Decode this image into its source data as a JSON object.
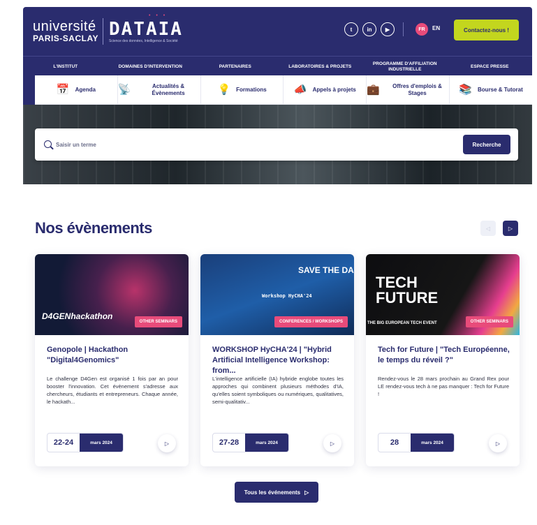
{
  "brand": {
    "universite": "université",
    "paris_saclay": "PARIS-SACLAY",
    "dataia_logo": "DATAIA",
    "dataia_tagline": "Science des données, Intelligence & Société"
  },
  "header": {
    "socials": [
      "twitter-icon",
      "linkedin-icon",
      "youtube-icon"
    ],
    "lang_fr": "FR",
    "lang_en": "EN",
    "contact_label": "Contactez-nous !"
  },
  "nav": {
    "items": [
      {
        "label": "L'institut"
      },
      {
        "label": "Domaines d'intervention"
      },
      {
        "label": "Partenaires"
      },
      {
        "label": "Laboratoires & projets"
      },
      {
        "label": "Programme d'affiliation industrielle"
      },
      {
        "label": "Espace presse"
      }
    ]
  },
  "subnav": {
    "items": [
      {
        "label": "Agenda",
        "icon": "calendar-icon"
      },
      {
        "label": "Actualités & Évènements",
        "icon": "megaphone-icon"
      },
      {
        "label": "Formations",
        "icon": "lightbulb-icon"
      },
      {
        "label": "Appels à projets",
        "icon": "announce-icon"
      },
      {
        "label": "Offres d'emplois & Stages",
        "icon": "briefcase-icon"
      },
      {
        "label": "Bourse & Tutorat",
        "icon": "books-icon"
      }
    ]
  },
  "search": {
    "placeholder": "Saisir un terme",
    "button_label": "Recherche"
  },
  "events": {
    "title": "Nos évènements",
    "cards": [
      {
        "image_text": "D4GENhackathon",
        "badge": "Other seminars",
        "title": "Genopole | Hackathon \"Digital4Genomics\"",
        "description": "Le challenge D4Gen est organisé 1 fois par an pour booster l'innovation. Cet évènement s'adresse aux chercheurs, étudiants et entrepreneurs. Chaque année, le hackath...",
        "days": "22-24",
        "month": "mars 2024"
      },
      {
        "image_text": "SAVE THE DA",
        "image_subtext": "Workshop HyCHA'24",
        "badge": "Conferences / workshops",
        "title": "WORKSHOP HyCHA'24 | \"Hybrid Artificial Intelligence Workshop: from...",
        "description": "L'intelligence artificielle (IA) hybride englobe toutes les approches qui combinent plusieurs méthodes d'IA, qu'elles soient symboliques ou numériques, qualitatives, semi-qualitativ...",
        "days": "27-28",
        "month": "mars 2024"
      },
      {
        "image_text": "TECH FUTURE",
        "image_subtext": "THE BIG EUROPEAN TECH EVENT",
        "badge": "Other seminars",
        "title": "Tech for Future | \"Tech Européenne, le temps du réveil ?\"",
        "description": "Rendez-vous le 28 mars prochain au Grand Rex pour LE rendez-vous tech à ne pas manquer : Tech for Future !",
        "days": "28",
        "month": "mars 2024"
      }
    ],
    "all_button": "Tous les événements"
  }
}
